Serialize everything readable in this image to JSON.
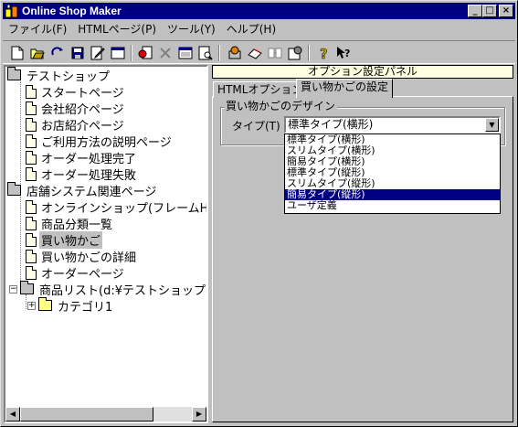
{
  "window": {
    "title": "Online Shop Maker"
  },
  "titlebar_buttons": {
    "minimize": "_",
    "maximize": "□",
    "close": "×"
  },
  "menu": [
    "ファイル(F)",
    "HTMLページ(P)",
    "ツール(Y)",
    "ヘルプ(H)"
  ],
  "toolbar": {
    "icons": [
      "new-icon",
      "open-icon",
      "reload-icon",
      "save-icon",
      "edit-icon",
      "window-icon",
      "stop-icon",
      "delete-icon",
      "panel-icon",
      "preview-icon",
      "publish-icon",
      "transfer-icon",
      "link-icon",
      "properties-icon",
      "help-icon",
      "context-help-icon"
    ]
  },
  "tree": {
    "root1": "テストショップ",
    "pages1": [
      "スタートページ",
      "会社紹介ページ",
      "お店紹介ページ",
      "ご利用方法の説明ページ",
      "オーダー処理完了",
      "オーダー処理失敗"
    ],
    "root2": "店舗システム関連ページ",
    "pages2": [
      "オンラインショップ(フレームH",
      "商品分類一覧",
      "買い物かご",
      "買い物かごの詳細",
      "オーダーページ"
    ],
    "product_list": "商品リスト(d:¥テストショップ)",
    "category": "カテゴリ1",
    "expander_minus": "−",
    "expander_plus": "+"
  },
  "scrollbar": {
    "left_arrow": "◀",
    "right_arrow": "▶"
  },
  "options": {
    "panel_title": "オプション設定パネル",
    "tabs": [
      "HTMLオプション",
      "買い物かごの設定"
    ],
    "group_title": "買い物かごのデザイン",
    "type_label": "タイプ(T)",
    "type_value": "標準タイプ(横形)",
    "combo_arrow": "▼",
    "dropdown": [
      "標準タイプ(横形)",
      "スリムタイプ(横形)",
      "簡易タイプ(横形)",
      "標準タイプ(縦形)",
      "スリムタイプ(縦形)",
      "簡易タイプ(縦形)",
      "ユーザ定義"
    ]
  }
}
